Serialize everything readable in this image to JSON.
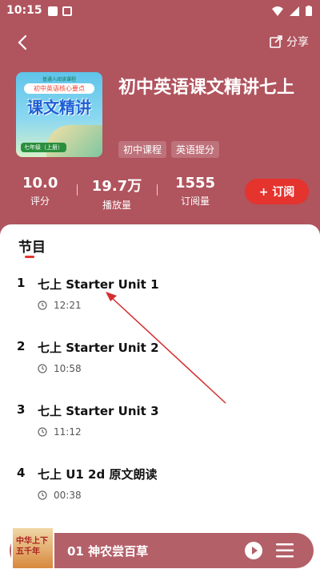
{
  "status_bar": {
    "time": "10:15"
  },
  "header": {
    "share_label": "分享"
  },
  "course": {
    "title": "初中英语课文精讲七上",
    "tags": [
      "初中课程",
      "英语提分"
    ],
    "cover": {
      "top_text": "普通人阅读课程",
      "sub_text": "初中英语核心要点",
      "main_text": "课文精讲",
      "grade_text": "七年级（上册）"
    }
  },
  "stats": [
    {
      "value": "10.0",
      "label": "评分"
    },
    {
      "value": "19.7万",
      "label": "播放量"
    },
    {
      "value": "1555",
      "label": "订阅量"
    }
  ],
  "subscribe_label": "+ 订阅",
  "section_title": "节目",
  "episodes": [
    {
      "index": "1",
      "title": "七上 Starter Unit 1",
      "duration": "12:21"
    },
    {
      "index": "2",
      "title": "七上 Starter Unit 2",
      "duration": "10:58"
    },
    {
      "index": "3",
      "title": "七上 Starter Unit 3",
      "duration": "11:12"
    },
    {
      "index": "4",
      "title": "七上 U1 2d 原文朗读",
      "duration": "00:38"
    }
  ],
  "player": {
    "title": "01 神农尝百草",
    "thumb_text": "中华上下五千年"
  },
  "colors": {
    "header_bg": "#b0545e",
    "accent": "#e5332e",
    "player_bg": "#b46069",
    "annotation_arrow": "#d32f2f"
  }
}
